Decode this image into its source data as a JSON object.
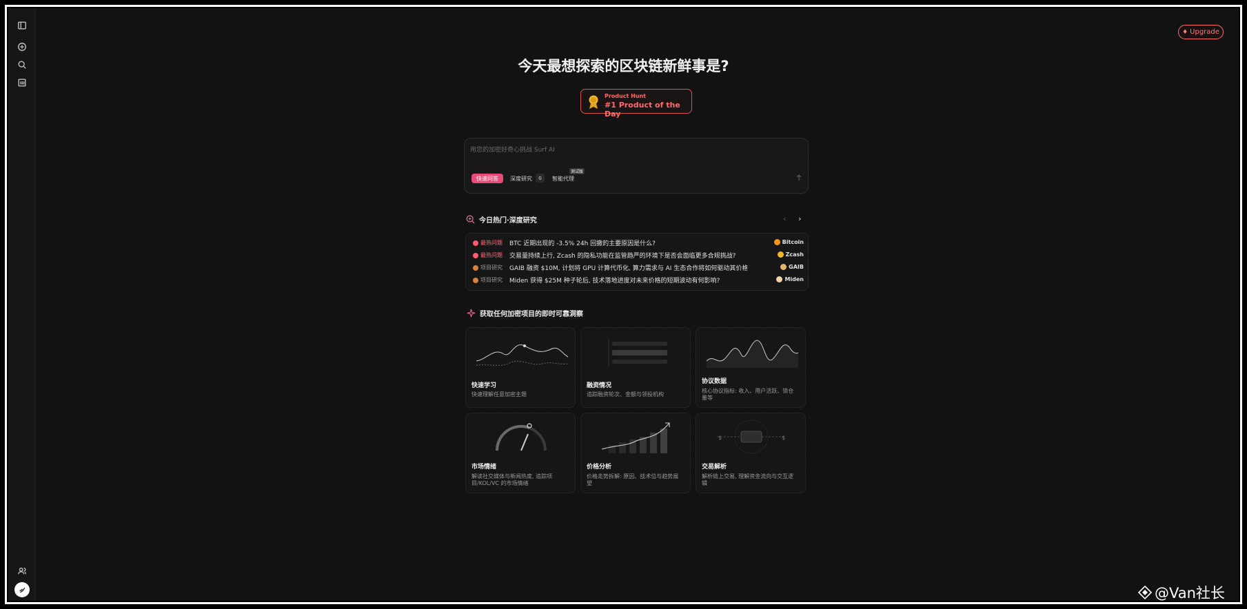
{
  "header": {
    "upgrade_label": "Upgrade",
    "headline": "今天最想探索的区块链新鲜事是?"
  },
  "product_hunt": {
    "small": "Product Hunt",
    "big": "#1 Product of the Day"
  },
  "search": {
    "placeholder": "用您的加密好奇心挑战 Surf AI",
    "modes": {
      "quick": "快速问答",
      "deep": "深度研究",
      "deep_count": "0",
      "agent": "智能代理",
      "agent_badge": "测试版"
    }
  },
  "trending": {
    "title": "今日热门·深度研究",
    "items": [
      {
        "tag": "最热问题",
        "text": "BTC 近期出现的 -3.5% 24h 回撤的主要原因是什么?",
        "coin": "Bitcoin"
      },
      {
        "tag": "最热问题",
        "text": "交易量持续上行, Zcash 的隐私功能在监管趋严的环境下是否会面临更多合规挑战?",
        "coin": "Zcash"
      },
      {
        "tag": "项目研究",
        "text": "GAIB 融资 $10M, 计划将 GPU 计算代币化, 算力需求与 AI 生态合作将如何驱动其价格...",
        "coin": "GAIB"
      },
      {
        "tag": "项目研究",
        "text": "Miden 获得 $25M 种子轮后, 技术落地进度对未来价格的短期波动有何影响?",
        "coin": "Miden"
      }
    ]
  },
  "insights": {
    "title": "获取任何加密项目的即时可靠洞察",
    "cards": [
      {
        "title": "快速学习",
        "desc": "快速理解任意加密主题"
      },
      {
        "title": "融资情况",
        "desc": "追踪融资轮次、金额与领投机构"
      },
      {
        "title": "协议数据",
        "desc": "核心协议指标: 收入、用户活跃、锁仓量等"
      },
      {
        "title": "市场情绪",
        "desc": "解读社交媒体与新闻热度, 追踪项目/KOL/VC 的市场情绪"
      },
      {
        "title": "价格分析",
        "desc": "价格走势拆解: 原因、技术位与趋势展望"
      },
      {
        "title": "交易解析",
        "desc": "解析链上交易, 理解资金流向与交互逻辑"
      }
    ]
  },
  "watermark": "@Van社长",
  "colors": {
    "accent": "#e94b78",
    "upgrade": "#ff6b6b",
    "background": "#121212"
  }
}
